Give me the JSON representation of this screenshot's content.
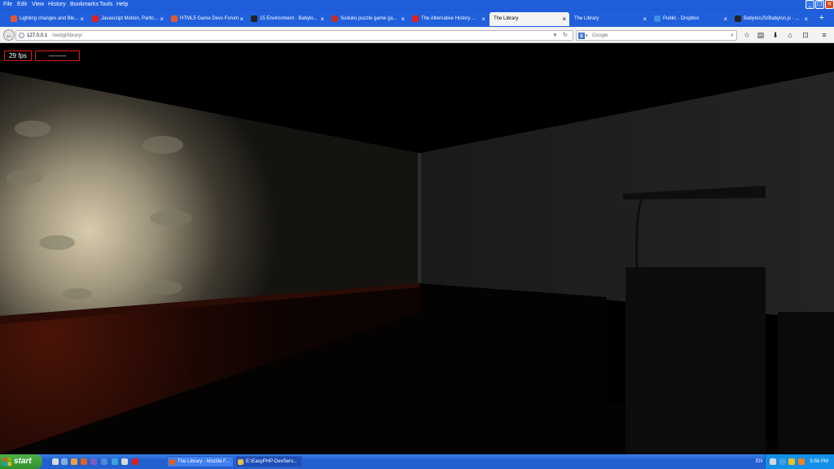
{
  "menubar": {
    "items": [
      "File",
      "Edit",
      "View",
      "History",
      "Bookmarks",
      "Tools",
      "Help"
    ]
  },
  "tabs": [
    {
      "label": "Lighting changes and Ble...",
      "icon": "html5-icon",
      "color": "#e4572e"
    },
    {
      "label": "Javascript Motion, Partic...",
      "icon": "youtube-icon",
      "color": "#e02020"
    },
    {
      "label": "HTML5 Game Devs Forum",
      "icon": "html5-icon",
      "color": "#e4572e"
    },
    {
      "label": "15 Environment · Babylo...",
      "icon": "github-icon",
      "color": "#222222"
    },
    {
      "label": "Soduko puzzle game (ja...",
      "icon": "page-icon",
      "color": "#c03030"
    },
    {
      "label": "The Alternative History ...",
      "icon": "youtube-icon",
      "color": "#e02020"
    },
    {
      "label": "The Library",
      "icon": "none",
      "color": "#f3f3f3"
    },
    {
      "label": "The Library",
      "icon": "none",
      "color": "#1f5fdc"
    },
    {
      "label": "Public - Dropbox",
      "icon": "dropbox-icon",
      "color": "#3d8fe8"
    },
    {
      "label": "BabylonJS/Babylon.js · ...",
      "icon": "github-icon",
      "color": "#222222"
    }
  ],
  "active_tab_index": 6,
  "navbar": {
    "url_host": "127.0.0.1",
    "url_path": "/webgl/library/",
    "search_placeholder": "Google"
  },
  "page": {
    "fps_label": "29 fps",
    "status_label": "--------"
  },
  "taskbar": {
    "start_label": "start",
    "tasks": [
      {
        "label": "The Library - Mozilla F...",
        "active": false
      },
      {
        "label": "E:\\EasyPHP-DevServ...",
        "active": true
      }
    ],
    "language": "EN",
    "clock": "5:56 PM"
  },
  "colors": {
    "xp_blue": "#1f5fdc",
    "fps_border": "#e01818",
    "start_green": "#2f8f2a"
  }
}
